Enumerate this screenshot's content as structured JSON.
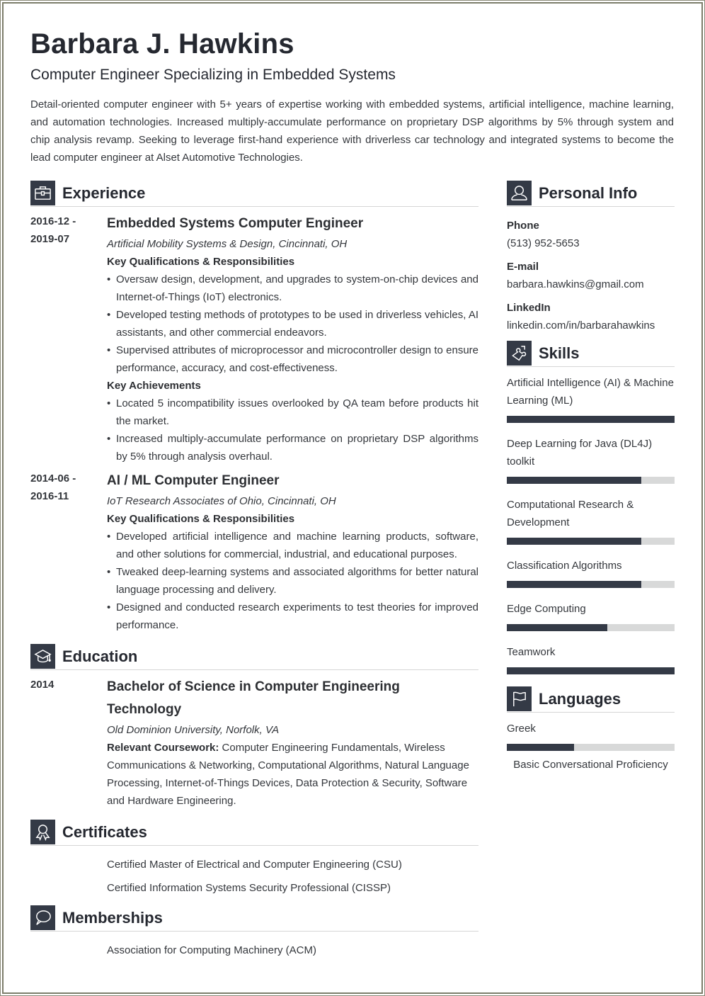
{
  "header": {
    "name": "Barbara J. Hawkins",
    "subtitle": "Computer Engineer Specializing in Embedded Systems",
    "summary": "Detail-oriented computer engineer with 5+ years of expertise working with embedded systems, artificial intelligence, machine learning, and automation technologies. Increased multiply-accumulate performance on proprietary DSP algorithms by 5% through system and chip analysis revamp. Seeking to leverage first-hand experience with driverless car technology and integrated systems to become the lead computer engineer at Alset Automotive Technologies."
  },
  "experience": {
    "title": "Experience",
    "icon": "briefcase-icon",
    "entries": [
      {
        "date": "2016-12 - 2019-07",
        "title": "Embedded Systems Computer Engineer",
        "org": "Artificial Mobility Systems & Design, Cincinnati, OH",
        "groups": [
          {
            "heading": "Key Qualifications & Responsibilities",
            "bullets": [
              "Oversaw design, development, and upgrades to system-on-chip devices and Internet-of-Things (IoT) electronics.",
              "Developed testing methods of prototypes to be used in driverless vehicles, AI assistants, and other commercial endeavors.",
              "Supervised attributes of microprocessor and microcontroller design to ensure performance, accuracy, and cost-effectiveness."
            ]
          },
          {
            "heading": "Key Achievements",
            "bullets": [
              "Located 5 incompatibility issues overlooked by QA team before products hit the market.",
              "Increased multiply-accumulate performance on proprietary DSP algorithms by 5% through analysis overhaul."
            ]
          }
        ]
      },
      {
        "date": "2014-06 - 2016-11",
        "title": "AI / ML Computer Engineer",
        "org": "IoT Research Associates of Ohio, Cincinnati, OH",
        "groups": [
          {
            "heading": "Key Qualifications & Responsibilities",
            "bullets": [
              "Developed artificial intelligence and machine learning products, software, and other solutions for commercial, industrial, and educational purposes.",
              "Tweaked deep-learning systems and associated algorithms for better natural language processing and delivery.",
              "Designed and conducted research experiments to test theories for improved performance."
            ]
          }
        ]
      }
    ]
  },
  "education": {
    "title": "Education",
    "icon": "graduation-cap-icon",
    "date": "2014",
    "degree": "Bachelor of Science in Computer Engineering Technology",
    "school": "Old Dominion University, Norfolk, VA",
    "coursework_label": "Relevant Coursework:",
    "coursework": " Computer Engineering Fundamentals, Wireless Communications & Networking, Computational Algorithms, Natural Language Processing, Internet-of-Things Devices, Data Protection & Security, Software and Hardware Engineering."
  },
  "certificates": {
    "title": "Certificates",
    "icon": "award-ribbon-icon",
    "items": [
      "Certified Master of Electrical and Computer Engineering (CSU)",
      "Certified Information Systems Security Professional (CISSP)"
    ]
  },
  "memberships": {
    "title": "Memberships",
    "icon": "speech-bubble-icon",
    "items": [
      "Association for Computing Machinery (ACM)"
    ]
  },
  "personal_info": {
    "title": "Personal Info",
    "icon": "user-icon",
    "fields": [
      {
        "label": "Phone",
        "value": "(513) 952-5653"
      },
      {
        "label": "E-mail",
        "value": "barbara.hawkins@gmail.com"
      },
      {
        "label": "LinkedIn",
        "value": "linkedin.com/in/barbarahawkins"
      }
    ]
  },
  "skills": {
    "title": "Skills",
    "icon": "puzzle-piece-icon",
    "items": [
      {
        "name": "Artificial Intelligence (AI) & Machine Learning (ML)",
        "level": 1.0
      },
      {
        "name": "Deep Learning for Java (DL4J) toolkit",
        "level": 0.8
      },
      {
        "name": "Computational Research & Development",
        "level": 0.8
      },
      {
        "name": "Classification Algorithms",
        "level": 0.8
      },
      {
        "name": "Edge Computing",
        "level": 0.6
      },
      {
        "name": "Teamwork",
        "level": 1.0
      }
    ]
  },
  "languages": {
    "title": "Languages",
    "icon": "flag-icon",
    "items": [
      {
        "name": "Greek",
        "level": 0.4,
        "proficiency": "Basic Conversational Proficiency"
      }
    ]
  },
  "colors": {
    "accent": "#343a46",
    "bar_track": "#d8d9d9",
    "text": "#2d2f33",
    "frame": "#7c7d6a"
  }
}
